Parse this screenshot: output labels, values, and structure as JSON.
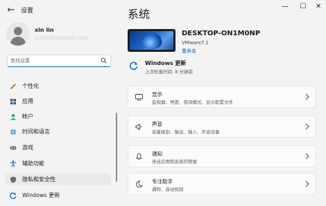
{
  "titlebar": {
    "app_title": "设置",
    "back_glyph": "←",
    "min_glyph": "—",
    "max_glyph": "☐",
    "close_glyph": "✕"
  },
  "user": {
    "name": "xin lin",
    "email": "xinlin@outlook.com"
  },
  "search": {
    "placeholder": "查找设置",
    "value": ""
  },
  "nav": {
    "items": [
      {
        "label": "个性化",
        "icon": "brush-icon"
      },
      {
        "label": "应用",
        "icon": "apps-icon"
      },
      {
        "label": "帐户",
        "icon": "person-icon"
      },
      {
        "label": "时间和语言",
        "icon": "globe-clock-icon"
      },
      {
        "label": "游戏",
        "icon": "gamepad-icon"
      },
      {
        "label": "辅助功能",
        "icon": "accessibility-icon"
      },
      {
        "label": "隐私和安全性",
        "icon": "shield-icon",
        "active": true
      },
      {
        "label": "Windows 更新",
        "icon": "windows-update-icon"
      }
    ]
  },
  "page": {
    "title": "系统"
  },
  "device": {
    "name": "DESKTOP-ON1M0NP",
    "model": "VMware7,1",
    "rename_label": "重命名"
  },
  "update": {
    "title": "Windows 更新",
    "subtitle": "上次检查时间: 8 分钟前"
  },
  "cards": [
    {
      "title": "显示",
      "desc": "监视器、亮度、夜间模式、显示配置文件",
      "icon": "display-icon"
    },
    {
      "title": "声音",
      "desc": "音量级别、输出、输入、声音设备",
      "icon": "speaker-icon"
    },
    {
      "title": "通知",
      "desc": "来自应用和系统的警报",
      "icon": "bell-icon"
    },
    {
      "title": "专注助手",
      "desc": "通知、自动规则",
      "icon": "moon-icon"
    }
  ],
  "colors": {
    "accent": "#0067c0",
    "background": "#f3f3f3",
    "card": "#fbfbfb"
  }
}
